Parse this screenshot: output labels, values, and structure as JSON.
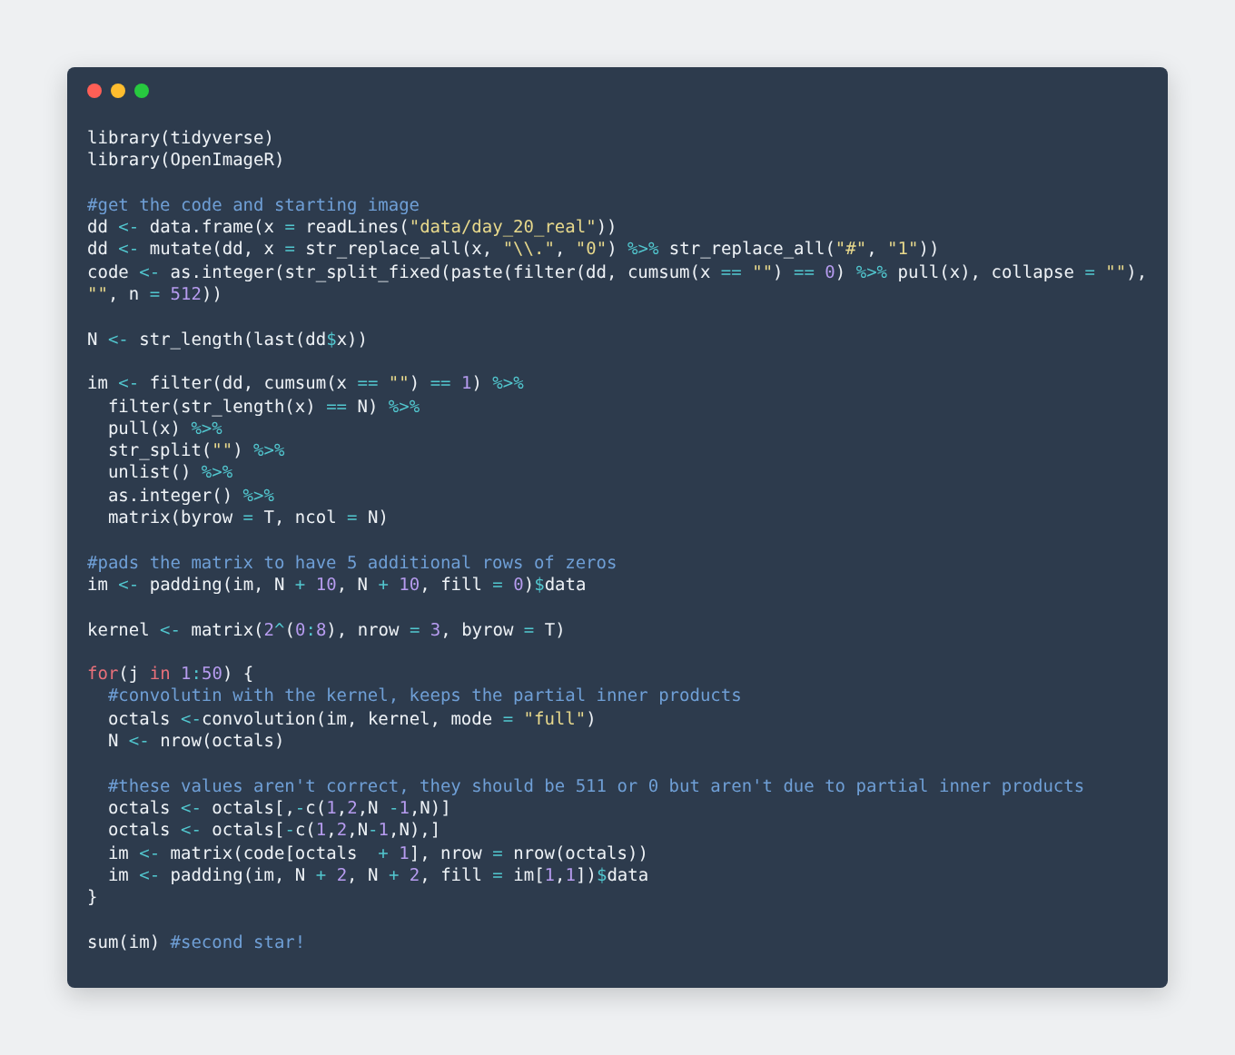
{
  "editor": {
    "blocks": [
      [
        [
          {
            "kind": "plain",
            "text": "library(tidyverse)"
          }
        ],
        [
          {
            "kind": "plain",
            "text": "library(OpenImageR)"
          }
        ]
      ],
      [
        [
          {
            "kind": "comment",
            "text": "#get the code and starting image"
          }
        ],
        [
          {
            "kind": "plain",
            "text": "dd "
          },
          {
            "kind": "op",
            "text": "<-"
          },
          {
            "kind": "plain",
            "text": " data.frame(x "
          },
          {
            "kind": "op",
            "text": "="
          },
          {
            "kind": "plain",
            "text": " readLines("
          },
          {
            "kind": "string",
            "text": "\"data/day_20_real\""
          },
          {
            "kind": "plain",
            "text": "))"
          }
        ],
        [
          {
            "kind": "plain",
            "text": "dd "
          },
          {
            "kind": "op",
            "text": "<-"
          },
          {
            "kind": "plain",
            "text": " mutate(dd, x "
          },
          {
            "kind": "op",
            "text": "="
          },
          {
            "kind": "plain",
            "text": " str_replace_all(x, "
          },
          {
            "kind": "string",
            "text": "\"\\\\.\""
          },
          {
            "kind": "plain",
            "text": ", "
          },
          {
            "kind": "string",
            "text": "\"0\""
          },
          {
            "kind": "plain",
            "text": ") "
          },
          {
            "kind": "op",
            "text": "%>%"
          },
          {
            "kind": "plain",
            "text": " str_replace_all("
          },
          {
            "kind": "string",
            "text": "\"#\""
          },
          {
            "kind": "plain",
            "text": ", "
          },
          {
            "kind": "string",
            "text": "\"1\""
          },
          {
            "kind": "plain",
            "text": "))"
          }
        ],
        [
          {
            "kind": "plain",
            "text": "code "
          },
          {
            "kind": "op",
            "text": "<-"
          },
          {
            "kind": "plain",
            "text": " as.integer(str_split_fixed(paste(filter(dd, cumsum(x "
          },
          {
            "kind": "op",
            "text": "=="
          },
          {
            "kind": "string",
            "text": " \"\""
          },
          {
            "kind": "plain",
            "text": ") "
          },
          {
            "kind": "op",
            "text": "=="
          },
          {
            "kind": "number",
            "text": " 0"
          },
          {
            "kind": "plain",
            "text": ") "
          },
          {
            "kind": "op",
            "text": "%>%"
          },
          {
            "kind": "plain",
            "text": " pull(x), collapse "
          },
          {
            "kind": "op",
            "text": "="
          },
          {
            "kind": "string",
            "text": " \"\""
          },
          {
            "kind": "plain",
            "text": "),"
          }
        ],
        [
          {
            "kind": "string",
            "text": "\"\""
          },
          {
            "kind": "plain",
            "text": ", n "
          },
          {
            "kind": "op",
            "text": "="
          },
          {
            "kind": "number",
            "text": " 512"
          },
          {
            "kind": "plain",
            "text": "))"
          }
        ]
      ],
      [
        [
          {
            "kind": "plain",
            "text": "N "
          },
          {
            "kind": "op",
            "text": "<-"
          },
          {
            "kind": "plain",
            "text": " str_length(last(dd"
          },
          {
            "kind": "op",
            "text": "$"
          },
          {
            "kind": "plain",
            "text": "x))"
          }
        ]
      ],
      [
        [
          {
            "kind": "plain",
            "text": "im "
          },
          {
            "kind": "op",
            "text": "<-"
          },
          {
            "kind": "plain",
            "text": " filter(dd, cumsum(x "
          },
          {
            "kind": "op",
            "text": "=="
          },
          {
            "kind": "string",
            "text": " \"\""
          },
          {
            "kind": "plain",
            "text": ") "
          },
          {
            "kind": "op",
            "text": "=="
          },
          {
            "kind": "number",
            "text": " 1"
          },
          {
            "kind": "plain",
            "text": ") "
          },
          {
            "kind": "op",
            "text": "%>%"
          }
        ],
        [
          {
            "kind": "plain",
            "text": "  filter(str_length(x) "
          },
          {
            "kind": "op",
            "text": "=="
          },
          {
            "kind": "plain",
            "text": " N) "
          },
          {
            "kind": "op",
            "text": "%>%"
          }
        ],
        [
          {
            "kind": "plain",
            "text": "  pull(x) "
          },
          {
            "kind": "op",
            "text": "%>%"
          }
        ],
        [
          {
            "kind": "plain",
            "text": "  str_split("
          },
          {
            "kind": "string",
            "text": "\"\""
          },
          {
            "kind": "plain",
            "text": ") "
          },
          {
            "kind": "op",
            "text": "%>%"
          }
        ],
        [
          {
            "kind": "plain",
            "text": "  unlist() "
          },
          {
            "kind": "op",
            "text": "%>%"
          }
        ],
        [
          {
            "kind": "plain",
            "text": "  as.integer() "
          },
          {
            "kind": "op",
            "text": "%>%"
          }
        ],
        [
          {
            "kind": "plain",
            "text": "  matrix(byrow "
          },
          {
            "kind": "op",
            "text": "="
          },
          {
            "kind": "plain",
            "text": " T, ncol "
          },
          {
            "kind": "op",
            "text": "="
          },
          {
            "kind": "plain",
            "text": " N)"
          }
        ]
      ],
      [
        [
          {
            "kind": "comment",
            "text": "#pads the matrix to have 5 additional rows of zeros"
          }
        ],
        [
          {
            "kind": "plain",
            "text": "im "
          },
          {
            "kind": "op",
            "text": "<-"
          },
          {
            "kind": "plain",
            "text": " padding(im, N "
          },
          {
            "kind": "op",
            "text": "+"
          },
          {
            "kind": "number",
            "text": " 10"
          },
          {
            "kind": "plain",
            "text": ", N "
          },
          {
            "kind": "op",
            "text": "+"
          },
          {
            "kind": "number",
            "text": " 10"
          },
          {
            "kind": "plain",
            "text": ", fill "
          },
          {
            "kind": "op",
            "text": "="
          },
          {
            "kind": "number",
            "text": " 0"
          },
          {
            "kind": "plain",
            "text": ")"
          },
          {
            "kind": "op",
            "text": "$"
          },
          {
            "kind": "plain",
            "text": "data"
          }
        ]
      ],
      [
        [
          {
            "kind": "plain",
            "text": "kernel "
          },
          {
            "kind": "op",
            "text": "<-"
          },
          {
            "kind": "plain",
            "text": " matrix("
          },
          {
            "kind": "number",
            "text": "2"
          },
          {
            "kind": "op",
            "text": "^"
          },
          {
            "kind": "plain",
            "text": "("
          },
          {
            "kind": "number",
            "text": "0"
          },
          {
            "kind": "op",
            "text": ":"
          },
          {
            "kind": "number",
            "text": "8"
          },
          {
            "kind": "plain",
            "text": "), nrow "
          },
          {
            "kind": "op",
            "text": "="
          },
          {
            "kind": "number",
            "text": " 3"
          },
          {
            "kind": "plain",
            "text": ", byrow "
          },
          {
            "kind": "op",
            "text": "="
          },
          {
            "kind": "plain",
            "text": " T)"
          }
        ]
      ],
      [
        [
          {
            "kind": "keyword",
            "text": "for"
          },
          {
            "kind": "plain",
            "text": "(j "
          },
          {
            "kind": "keyword",
            "text": "in"
          },
          {
            "kind": "number",
            "text": " 1"
          },
          {
            "kind": "op",
            "text": ":"
          },
          {
            "kind": "number",
            "text": "50"
          },
          {
            "kind": "plain",
            "text": ") {"
          }
        ],
        [
          {
            "kind": "comment",
            "text": "  #convolutin with the kernel, keeps the partial inner products"
          }
        ],
        [
          {
            "kind": "plain",
            "text": "  octals "
          },
          {
            "kind": "op",
            "text": "<-"
          },
          {
            "kind": "plain",
            "text": "convolution(im, kernel, mode "
          },
          {
            "kind": "op",
            "text": "="
          },
          {
            "kind": "string",
            "text": " \"full\""
          },
          {
            "kind": "plain",
            "text": ")"
          }
        ],
        [
          {
            "kind": "plain",
            "text": "  N "
          },
          {
            "kind": "op",
            "text": "<-"
          },
          {
            "kind": "plain",
            "text": " nrow(octals)"
          }
        ]
      ],
      [
        [
          {
            "kind": "comment",
            "text": "  #these values aren't correct, they should be 511 or 0 but aren't due to partial inner products"
          }
        ],
        [
          {
            "kind": "plain",
            "text": "  octals "
          },
          {
            "kind": "op",
            "text": "<-"
          },
          {
            "kind": "plain",
            "text": " octals[,"
          },
          {
            "kind": "op",
            "text": "-"
          },
          {
            "kind": "plain",
            "text": "c("
          },
          {
            "kind": "number",
            "text": "1"
          },
          {
            "kind": "plain",
            "text": ","
          },
          {
            "kind": "number",
            "text": "2"
          },
          {
            "kind": "plain",
            "text": ",N "
          },
          {
            "kind": "op",
            "text": "-"
          },
          {
            "kind": "number",
            "text": "1"
          },
          {
            "kind": "plain",
            "text": ",N)]"
          }
        ],
        [
          {
            "kind": "plain",
            "text": "  octals "
          },
          {
            "kind": "op",
            "text": "<-"
          },
          {
            "kind": "plain",
            "text": " octals["
          },
          {
            "kind": "op",
            "text": "-"
          },
          {
            "kind": "plain",
            "text": "c("
          },
          {
            "kind": "number",
            "text": "1"
          },
          {
            "kind": "plain",
            "text": ","
          },
          {
            "kind": "number",
            "text": "2"
          },
          {
            "kind": "plain",
            "text": ",N"
          },
          {
            "kind": "op",
            "text": "-"
          },
          {
            "kind": "number",
            "text": "1"
          },
          {
            "kind": "plain",
            "text": ",N),]"
          }
        ],
        [
          {
            "kind": "plain",
            "text": "  im "
          },
          {
            "kind": "op",
            "text": "<-"
          },
          {
            "kind": "plain",
            "text": " matrix(code[octals  "
          },
          {
            "kind": "op",
            "text": "+"
          },
          {
            "kind": "number",
            "text": " 1"
          },
          {
            "kind": "plain",
            "text": "], nrow "
          },
          {
            "kind": "op",
            "text": "="
          },
          {
            "kind": "plain",
            "text": " nrow(octals))"
          }
        ],
        [
          {
            "kind": "plain",
            "text": "  im "
          },
          {
            "kind": "op",
            "text": "<-"
          },
          {
            "kind": "plain",
            "text": " padding(im, N "
          },
          {
            "kind": "op",
            "text": "+"
          },
          {
            "kind": "number",
            "text": " 2"
          },
          {
            "kind": "plain",
            "text": ", N "
          },
          {
            "kind": "op",
            "text": "+"
          },
          {
            "kind": "number",
            "text": " 2"
          },
          {
            "kind": "plain",
            "text": ", fill "
          },
          {
            "kind": "op",
            "text": "="
          },
          {
            "kind": "plain",
            "text": " im["
          },
          {
            "kind": "number",
            "text": "1"
          },
          {
            "kind": "plain",
            "text": ","
          },
          {
            "kind": "number",
            "text": "1"
          },
          {
            "kind": "plain",
            "text": "])"
          },
          {
            "kind": "op",
            "text": "$"
          },
          {
            "kind": "plain",
            "text": "data"
          }
        ],
        [
          {
            "kind": "plain",
            "text": "}"
          }
        ]
      ],
      [
        [
          {
            "kind": "plain",
            "text": "sum(im) "
          },
          {
            "kind": "comment",
            "text": "#second star!"
          }
        ]
      ]
    ]
  }
}
